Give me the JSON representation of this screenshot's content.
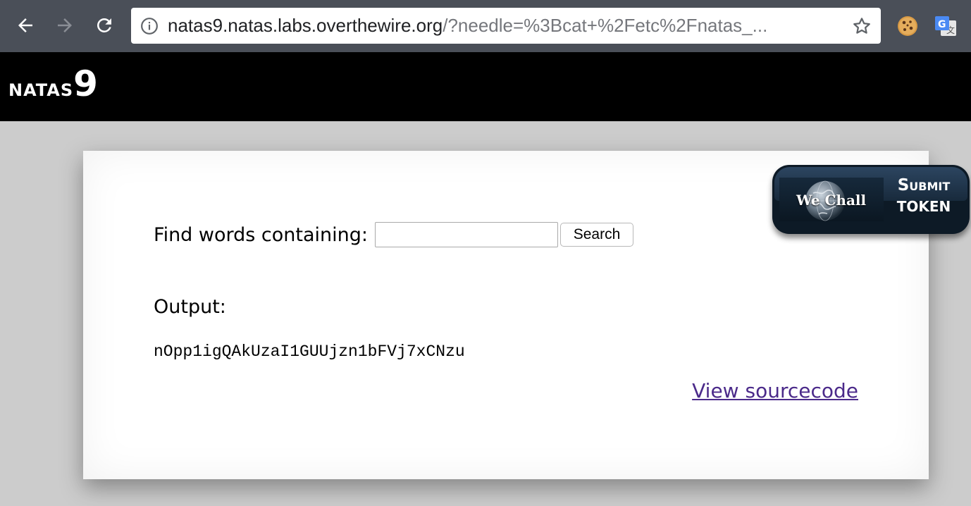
{
  "browser": {
    "url_host": "natas9.natas.labs.overthewire.org",
    "url_rest": "/?needle=%3Bcat+%2Fetc%2Fnatas_...",
    "icons": {
      "back": "arrow-left-icon",
      "forward": "arrow-right-icon",
      "reload": "reload-icon",
      "site_info": "info-circle-icon",
      "bookmark": "star-icon",
      "extension_1": "cookie-icon",
      "extension_2": "google-translate-icon"
    }
  },
  "header": {
    "title_word": "natas",
    "title_number": "9"
  },
  "search": {
    "label": "Find words containing:",
    "input_value": "",
    "button_label": "Search"
  },
  "output": {
    "label": "Output:",
    "text": "nOpp1igQAkUzaI1GUUjzn1bFVj7xCNzu"
  },
  "links": {
    "view_source": "View sourcecode"
  },
  "wechall": {
    "logo_text": "We Chall",
    "line1": "Submit",
    "line2": "TOKEN"
  },
  "colors": {
    "page_background": "#cccccc",
    "header_background": "#000000",
    "toolbar": "#4a4f58",
    "link": "#4b2a8a",
    "badge": "#0d1a26"
  }
}
